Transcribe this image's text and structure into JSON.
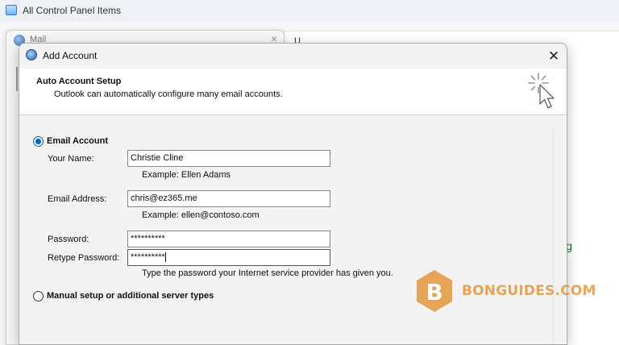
{
  "control_panel": {
    "title": "All Control Panel Items",
    "right_fragment": "U",
    "right_glyph": "g"
  },
  "mail_window": {
    "title": "Mail",
    "close_glyph": "×"
  },
  "dialog": {
    "title": "Add Account",
    "close_glyph": "✕",
    "header": {
      "title": "Auto Account Setup",
      "description": "Outlook can automatically configure many email accounts."
    },
    "options": {
      "email_account": {
        "label": "Email Account",
        "selected": true
      },
      "manual_setup": {
        "label": "Manual setup or additional server types",
        "selected": false
      }
    },
    "fields": {
      "your_name": {
        "label": "Your Name:",
        "value": "Christie Cline",
        "hint": "Example: Ellen Adams"
      },
      "email_address": {
        "label": "Email Address:",
        "value": "chris@ez365.me",
        "hint": "Example: ellen@contoso.com"
      },
      "password": {
        "label": "Password:",
        "value": "**********"
      },
      "retype_password": {
        "label": "Retype Password:",
        "value": "**********",
        "hint": "Type the password your Internet service provider has given you."
      }
    }
  },
  "watermark": {
    "letter": "B",
    "text": "BONGUIDES.COM",
    "color": "#e48a24"
  }
}
